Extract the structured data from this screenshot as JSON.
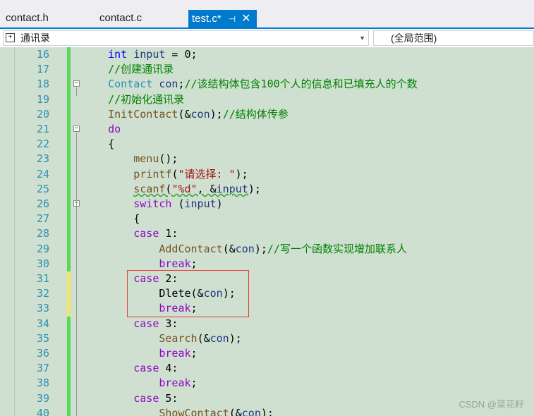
{
  "tabs": [
    {
      "label": "contact.h",
      "active": false
    },
    {
      "label": "contact.c",
      "active": false
    },
    {
      "label": "test.c*",
      "active": true,
      "pin_icon": "pin-icon",
      "close_icon": "close-icon"
    }
  ],
  "navbar": {
    "scope": "通讯录",
    "scope_icon": "class-scope-icon",
    "range": "(全局范围)"
  },
  "colors": {
    "accent": "#007acc",
    "editor_bg": "#cfe0d1",
    "line_number": "#2b91af",
    "change_saved": "#5bd85b",
    "change_unsaved": "#f0e66a",
    "highlight_box": "#e83a3a"
  },
  "code_lines": [
    {
      "num": "16",
      "change": "saved",
      "fold": "none",
      "tokens": [
        {
          "t": "    "
        },
        {
          "t": "int",
          "c": "kw"
        },
        {
          "t": " "
        },
        {
          "t": "input",
          "c": "var"
        },
        {
          "t": " = 0;"
        }
      ]
    },
    {
      "num": "17",
      "change": "saved",
      "fold": "none",
      "tokens": [
        {
          "t": "    "
        },
        {
          "t": "//创建通讯录",
          "c": "cm"
        }
      ]
    },
    {
      "num": "18",
      "change": "saved",
      "fold": "start",
      "tokens": [
        {
          "t": "    "
        },
        {
          "t": "Contact",
          "c": "ty"
        },
        {
          "t": " "
        },
        {
          "t": "con",
          "c": "var"
        },
        {
          "t": ";"
        },
        {
          "t": "//该结构体包含100个人的信息和已填充人的个数",
          "c": "cm"
        }
      ]
    },
    {
      "num": "19",
      "change": "saved",
      "fold": "none",
      "tokens": [
        {
          "t": "    "
        },
        {
          "t": "//初始化通讯录",
          "c": "cm"
        }
      ]
    },
    {
      "num": "20",
      "change": "saved",
      "fold": "none",
      "tokens": [
        {
          "t": "    "
        },
        {
          "t": "InitContact",
          "c": "fn"
        },
        {
          "t": "(&"
        },
        {
          "t": "con",
          "c": "var"
        },
        {
          "t": ");"
        },
        {
          "t": "//结构体传参",
          "c": "cm"
        }
      ]
    },
    {
      "num": "21",
      "change": "saved",
      "fold": "start",
      "tokens": [
        {
          "t": "    "
        },
        {
          "t": "do",
          "c": "kw2"
        }
      ]
    },
    {
      "num": "22",
      "change": "saved",
      "fold": "none",
      "tokens": [
        {
          "t": "    {"
        }
      ]
    },
    {
      "num": "23",
      "change": "saved",
      "fold": "none",
      "tokens": [
        {
          "t": "        "
        },
        {
          "t": "menu",
          "c": "fn"
        },
        {
          "t": "();"
        }
      ]
    },
    {
      "num": "24",
      "change": "saved",
      "fold": "none",
      "tokens": [
        {
          "t": "        "
        },
        {
          "t": "printf",
          "c": "fn"
        },
        {
          "t": "("
        },
        {
          "t": "\"请选择: \"",
          "c": "str"
        },
        {
          "t": ");"
        }
      ]
    },
    {
      "num": "25",
      "change": "saved",
      "fold": "none",
      "tokens": [
        {
          "t": "        "
        },
        {
          "t": "scanf",
          "c": "fn",
          "s": 1
        },
        {
          "t": "(",
          "s": 1
        },
        {
          "t": "\"%d\"",
          "c": "str",
          "s": 1
        },
        {
          "t": ", &",
          "s": 1
        },
        {
          "t": "input",
          "c": "var",
          "s": 1
        },
        {
          "t": ");"
        }
      ]
    },
    {
      "num": "26",
      "change": "saved",
      "fold": "start",
      "tokens": [
        {
          "t": "        "
        },
        {
          "t": "switch",
          "c": "kw2"
        },
        {
          "t": " ("
        },
        {
          "t": "input",
          "c": "var"
        },
        {
          "t": ")"
        }
      ]
    },
    {
      "num": "27",
      "change": "saved",
      "fold": "none",
      "tokens": [
        {
          "t": "        {"
        }
      ]
    },
    {
      "num": "28",
      "change": "saved",
      "fold": "none",
      "tokens": [
        {
          "t": "        "
        },
        {
          "t": "case",
          "c": "kw2"
        },
        {
          "t": " 1:"
        }
      ]
    },
    {
      "num": "29",
      "change": "saved",
      "fold": "none",
      "tokens": [
        {
          "t": "            "
        },
        {
          "t": "AddContact",
          "c": "fn"
        },
        {
          "t": "(&"
        },
        {
          "t": "con",
          "c": "var"
        },
        {
          "t": ");"
        },
        {
          "t": "//写一个函数实现增加联系人",
          "c": "cm"
        }
      ]
    },
    {
      "num": "30",
      "change": "saved",
      "fold": "none",
      "tokens": [
        {
          "t": "            "
        },
        {
          "t": "break",
          "c": "kw2"
        },
        {
          "t": ";"
        }
      ]
    },
    {
      "num": "31",
      "change": "unsaved",
      "fold": "none",
      "tokens": [
        {
          "t": "        "
        },
        {
          "t": "case",
          "c": "kw2"
        },
        {
          "t": " 2:"
        }
      ]
    },
    {
      "num": "32",
      "change": "unsaved",
      "fold": "none",
      "tokens": [
        {
          "t": "            "
        },
        {
          "t": "Dlete"
        },
        {
          "t": "(&"
        },
        {
          "t": "con",
          "c": "var"
        },
        {
          "t": ");"
        }
      ]
    },
    {
      "num": "33",
      "change": "unsaved",
      "fold": "none",
      "tokens": [
        {
          "t": "            "
        },
        {
          "t": "break",
          "c": "kw2"
        },
        {
          "t": ";"
        }
      ]
    },
    {
      "num": "34",
      "change": "saved",
      "fold": "none",
      "tokens": [
        {
          "t": "        "
        },
        {
          "t": "case",
          "c": "kw2"
        },
        {
          "t": " 3:"
        }
      ]
    },
    {
      "num": "35",
      "change": "saved",
      "fold": "none",
      "tokens": [
        {
          "t": "            "
        },
        {
          "t": "Search",
          "c": "fn"
        },
        {
          "t": "(&"
        },
        {
          "t": "con",
          "c": "var"
        },
        {
          "t": ");"
        }
      ]
    },
    {
      "num": "36",
      "change": "saved",
      "fold": "none",
      "tokens": [
        {
          "t": "            "
        },
        {
          "t": "break",
          "c": "kw2"
        },
        {
          "t": ";"
        }
      ]
    },
    {
      "num": "37",
      "change": "saved",
      "fold": "none",
      "tokens": [
        {
          "t": "        "
        },
        {
          "t": "case",
          "c": "kw2"
        },
        {
          "t": " 4:"
        }
      ]
    },
    {
      "num": "38",
      "change": "saved",
      "fold": "none",
      "tokens": [
        {
          "t": "            "
        },
        {
          "t": "break",
          "c": "kw2"
        },
        {
          "t": ";"
        }
      ]
    },
    {
      "num": "39",
      "change": "saved",
      "fold": "none",
      "tokens": [
        {
          "t": "        "
        },
        {
          "t": "case",
          "c": "kw2"
        },
        {
          "t": " 5:"
        }
      ]
    },
    {
      "num": "40",
      "change": "saved",
      "fold": "none",
      "tokens": [
        {
          "t": "            "
        },
        {
          "t": "ShowContact",
          "c": "fn"
        },
        {
          "t": "(&"
        },
        {
          "t": "con",
          "c": "var"
        },
        {
          "t": ");"
        }
      ]
    }
  ],
  "watermark": "CSDN @菜花籽"
}
